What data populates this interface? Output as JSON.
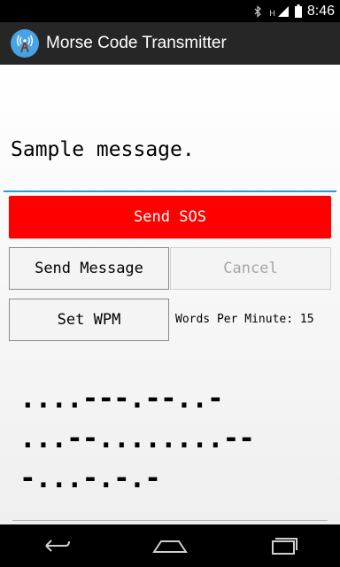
{
  "status_bar": {
    "time": "8:46",
    "signal_label": "H",
    "icons": [
      "bluetooth-icon",
      "signal-icon",
      "battery-icon"
    ]
  },
  "app": {
    "title": "Morse Code Transmitter",
    "icon": "radio-tower-icon"
  },
  "message": {
    "value": "Sample message."
  },
  "buttons": {
    "sos": "Send SOS",
    "send_message": "Send Message",
    "cancel": "Cancel",
    "set_wpm": "Set WPM"
  },
  "wpm": {
    "label": "Words Per Minute: 15"
  },
  "morse": {
    "line1": "....---.--..-",
    "line2": "...--........--",
    "line3": "-...-.-.-"
  },
  "navbar": {
    "icons": [
      "back-icon",
      "home-icon",
      "recents-icon"
    ]
  },
  "colors": {
    "sos": "#ff0000",
    "accent": "#2a9bd3",
    "action_bar": "#262626",
    "app_icon_bg": "#47a3e5"
  }
}
